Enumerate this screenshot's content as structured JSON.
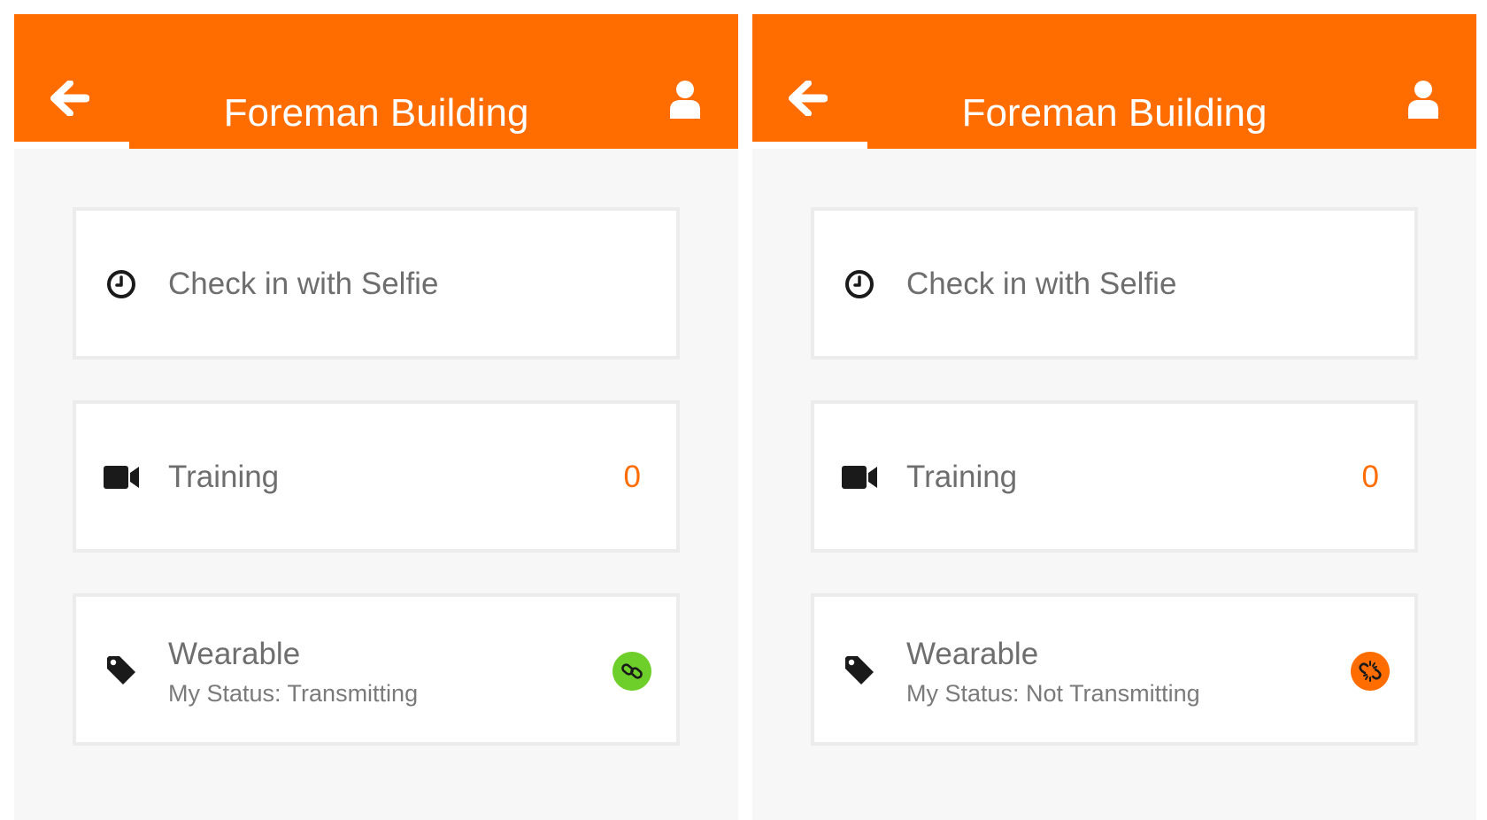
{
  "screens": [
    {
      "header": {
        "title": "Foreman Building",
        "back_icon": "arrow-left-icon",
        "user_icon": "user-icon"
      },
      "cards": [
        {
          "label": "Check in with Selfie",
          "icon": "clock-icon"
        },
        {
          "label": "Training",
          "icon": "video-camera-icon",
          "count": "0"
        },
        {
          "label": "Wearable",
          "icon": "tag-icon",
          "status": "My Status: Transmitting",
          "status_icon": "link-icon",
          "status_color": "#6fcf2a"
        }
      ]
    },
    {
      "header": {
        "title": "Foreman Building",
        "back_icon": "arrow-left-icon",
        "user_icon": "user-icon"
      },
      "cards": [
        {
          "label": "Check in with Selfie",
          "icon": "clock-icon"
        },
        {
          "label": "Training",
          "icon": "video-camera-icon",
          "count": "0"
        },
        {
          "label": "Wearable",
          "icon": "tag-icon",
          "status": "My Status: Not Transmitting",
          "status_icon": "broken-link-icon",
          "status_color": "#ff6c00"
        }
      ]
    }
  ],
  "colors": {
    "accent": "#ff6c00",
    "background": "#f7f7f7",
    "card": "#ffffff",
    "text": "#6e6e6e"
  }
}
